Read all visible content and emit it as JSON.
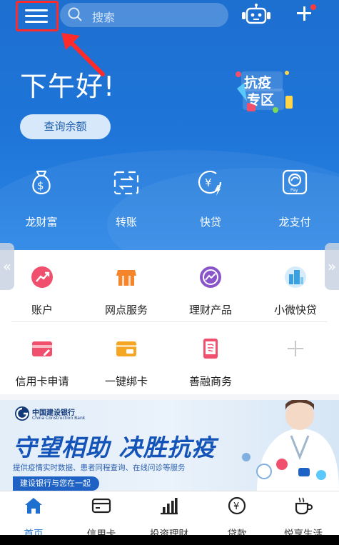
{
  "header": {
    "search_placeholder": "搜索"
  },
  "greeting": "下午好!",
  "balance_button": "查询余额",
  "promo_badge": {
    "line1": "抗疫",
    "line2": "专区"
  },
  "quick_actions": [
    {
      "label": "龙财富",
      "icon": "money-bag-icon"
    },
    {
      "label": "转账",
      "icon": "transfer-icon"
    },
    {
      "label": "快贷",
      "icon": "quick-loan-icon"
    },
    {
      "label": "龙支付",
      "icon": "long-pay-icon"
    }
  ],
  "services": [
    {
      "label": "账户",
      "icon": "account-icon",
      "color": "#f0506e"
    },
    {
      "label": "网点服务",
      "icon": "branch-icon",
      "color": "#f5852a"
    },
    {
      "label": "理财产品",
      "icon": "wealth-product-icon",
      "color": "#8a55c9"
    },
    {
      "label": "小微快贷",
      "icon": "small-loan-icon",
      "color": "#3aa0e0"
    },
    {
      "label": "信用卡申请",
      "icon": "credit-card-apply-icon",
      "color": "#f0506e"
    },
    {
      "label": "一键绑卡",
      "icon": "bind-card-icon",
      "color": "#f5a623"
    },
    {
      "label": "善融商务",
      "icon": "shanrong-icon",
      "color": "#f0506e"
    }
  ],
  "banner": {
    "bank_name": "中国建设银行",
    "bank_name_en": "China Construction Bank",
    "slogan": "守望相助 决胜抗疫",
    "subtitle": "提供疫情实时数据、患者同程查询、在线问诊等服务",
    "tagline": "建设银行与您在一起"
  },
  "bottom_nav": [
    {
      "label": "首页",
      "icon": "home-icon",
      "active": true
    },
    {
      "label": "信用卡",
      "icon": "credit-card-icon",
      "active": false
    },
    {
      "label": "投资理财",
      "icon": "invest-chart-icon",
      "active": false
    },
    {
      "label": "贷款",
      "icon": "loan-yen-icon",
      "active": false
    },
    {
      "label": "悦享生活",
      "icon": "coffee-icon",
      "active": false
    }
  ],
  "colors": {
    "primary_blue": "#1d6fd0",
    "annotation_red": "#ff2b2b"
  }
}
